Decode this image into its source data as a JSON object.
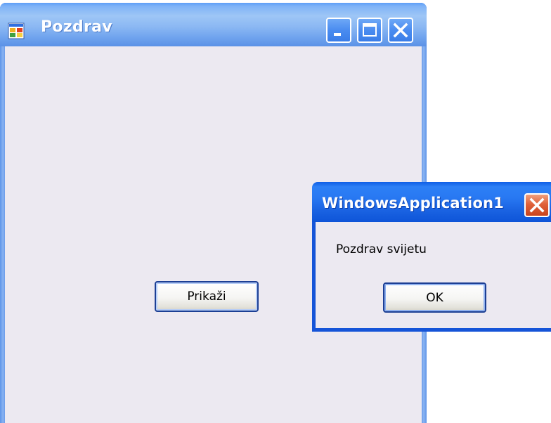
{
  "main_window": {
    "title": "Pozdrav",
    "app_icon": "windows-form-icon",
    "controls": {
      "minimize_icon": "minimize-icon",
      "maximize_icon": "maximize-icon",
      "close_icon": "close-icon"
    },
    "button_label": "Prikaži"
  },
  "message_box": {
    "title": "WindowsApplication1",
    "close_icon": "close-icon",
    "message": "Pozdrav svijetu",
    "ok_label": "OK"
  },
  "colors": {
    "titlebar_blue": "#2878f2",
    "client_bg": "#ece9f1",
    "close_red": "#e0613a"
  }
}
